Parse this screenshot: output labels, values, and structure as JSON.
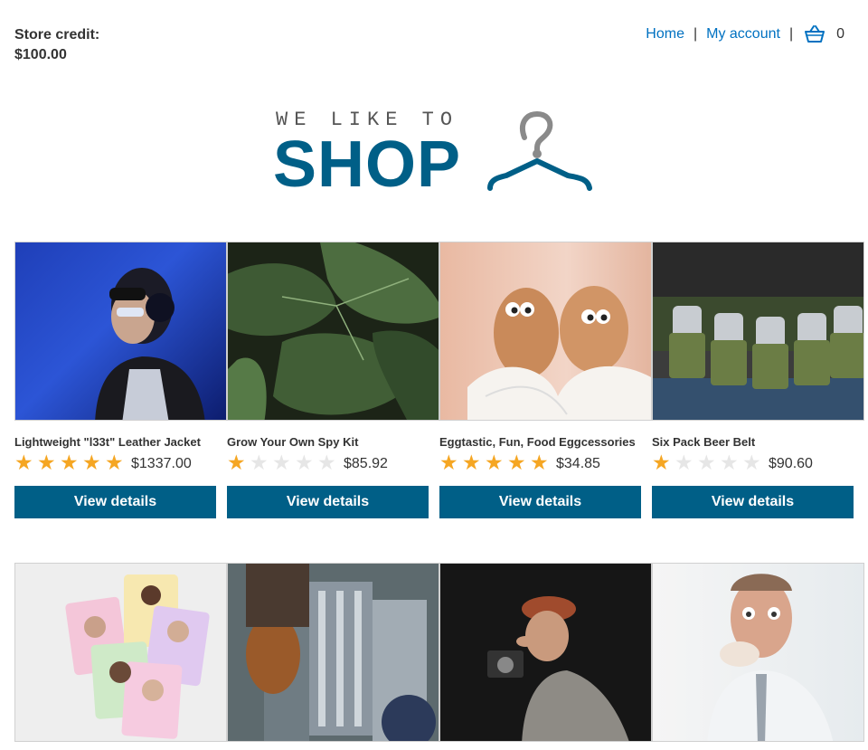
{
  "header": {
    "store_credit_label": "Store credit:",
    "store_credit_value": "$100.00",
    "nav": {
      "home": "Home",
      "separator": "|",
      "account": "My account",
      "cart_count": "0"
    }
  },
  "logo": {
    "tagline": "WE LIKE TO",
    "word": "SHOP",
    "icon": "hanger-icon"
  },
  "products": [
    {
      "name": "Lightweight \"l33t\" Leather Jacket",
      "rating": 5,
      "price": "$1337.00",
      "button": "View details"
    },
    {
      "name": "Grow Your Own Spy Kit",
      "rating": 1,
      "price": "$85.92",
      "button": "View details"
    },
    {
      "name": "Eggtastic, Fun, Food Eggcessories",
      "rating": 5,
      "price": "$34.85",
      "button": "View details"
    },
    {
      "name": "Six Pack Beer Belt",
      "rating": 1,
      "price": "$90.60",
      "button": "View details"
    }
  ],
  "colors": {
    "brand": "#005f87",
    "link": "#0071c1",
    "star_on": "#f5a623",
    "star_off": "#e6e6e6"
  }
}
